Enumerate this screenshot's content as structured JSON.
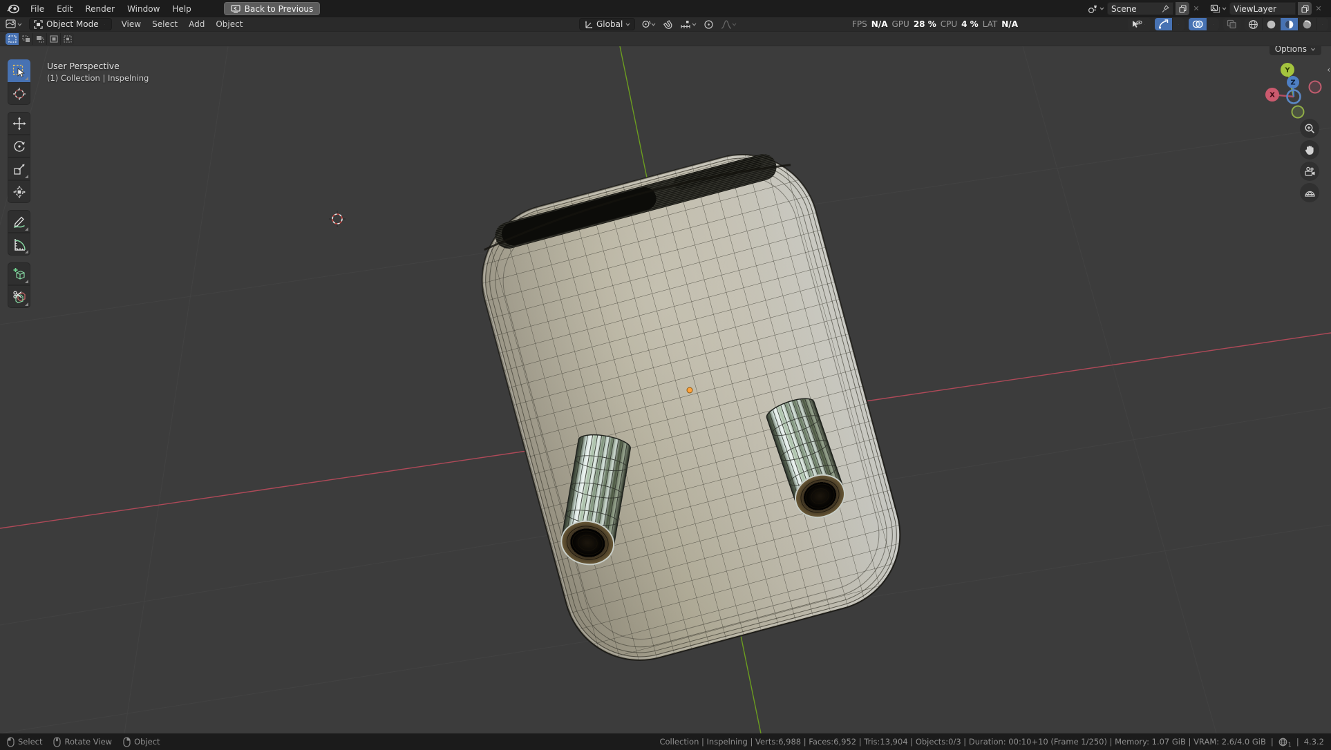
{
  "topbar": {
    "menus": [
      "File",
      "Edit",
      "Render",
      "Window",
      "Help"
    ],
    "back_label": "Back to Previous",
    "scene": {
      "value": "Scene"
    },
    "viewlayer": {
      "value": "ViewLayer"
    },
    "close_glyph": "✕"
  },
  "header": {
    "mode_label": "Object Mode",
    "menus": [
      "View",
      "Select",
      "Add",
      "Object"
    ],
    "orientation_label": "Global",
    "stats": [
      {
        "label": "FPS",
        "value": "N/A"
      },
      {
        "label": "GPU",
        "value": "28 %"
      },
      {
        "label": "CPU",
        "value": "4 %"
      },
      {
        "label": "LAT",
        "value": "N/A"
      }
    ]
  },
  "viewport": {
    "options_label": "Options",
    "view_label": "User Perspective",
    "context_label": "(1) Collection | Inspelning",
    "gizmo": {
      "x": "X",
      "y": "Y",
      "z": "Z"
    },
    "collapse_glyph": "‹"
  },
  "statusbar": {
    "hints": [
      "Select",
      "Rotate View",
      "Object"
    ],
    "info": "Collection | Inspelning | Verts:6,988 | Faces:6,952 | Tris:13,904 | Objects:0/3 | Duration: 00:10+10 (Frame 1/250) | Memory: 1.07 GiB | VRAM: 2.6/4.0 GiB",
    "sep": "|",
    "globe_sub": "1",
    "version": "4.3.2"
  },
  "colors": {
    "accent": "#4772b3",
    "axis_x": "#bc4b5c",
    "axis_y": "#71a81c",
    "mesh_base": "#ada895",
    "background": "#3c3c3c"
  }
}
